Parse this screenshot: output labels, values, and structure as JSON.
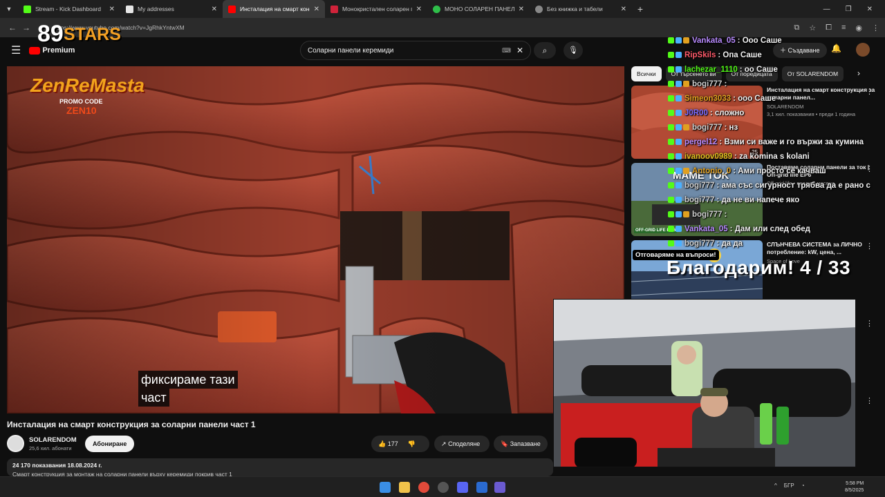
{
  "browser": {
    "tabs": [
      {
        "title": "Stream - Kick Dashboard",
        "color": "#53fc18",
        "active": false
      },
      {
        "title": "My addresses",
        "color": "#e6e6e6",
        "active": false
      },
      {
        "title": "Инсталация на смарт конс",
        "color": "#ff0000",
        "active": true
      },
      {
        "title": "Монокристален соларен пане",
        "color": "#d0233a",
        "active": false
      },
      {
        "title": "МОНО СОЛАРЕН ПАНЕЛ 580W",
        "color": "#2fbf4a",
        "active": false
      },
      {
        "title": "Без книжка и табели",
        "color": "#888888",
        "active": false
      }
    ],
    "close_glyph": "✕",
    "newtab_glyph": "+",
    "url": "https://www.youtube.com/watch?v=JgRhkYntwXM"
  },
  "yt": {
    "logo": "Premium",
    "search_query": "Соларни панели керемиди",
    "create_label": "Създаване",
    "video_title": "Инсталация на смарт конструкция за соларни панели част 1",
    "channel_name": "SOLARENDOM",
    "channel_subs": "25,6 хил. абонати",
    "subscribe_label": "Абониране",
    "likes": "177",
    "share_label": "Споделяне",
    "save_label": "Запазване",
    "desc_stats": "24 170 показвания  18.08.2024 г.",
    "desc_text": "Смарт конструкция за монтаж на соларни панели върху керемиди покрив част 1",
    "subtitle_line1": "фиксираме тази",
    "subtitle_line2": "част"
  },
  "chips": [
    "Всички",
    "От търсенето ви",
    "От поредицата",
    "От SOLARENDOM"
  ],
  "recommendations": [
    {
      "title": "Инсталация на смарт конструкция за соларни панел...",
      "channel": "SOLARENDOM",
      "meta": "3,1 хил. показвания • преди 1 година",
      "duration": "25"
    },
    {
      "title": "Поставяме соларни панели за ток | Off-grid life EP6",
      "channel": "",
      "meta": "Off-grid life • преди 3 месеца",
      "duration": "",
      "badge": "MAME TOK",
      "tag": "OFF-GRID LIFE EP 6"
    },
    {
      "title": "СЛЪНЧЕВА СИСТЕМА за ЛИЧНО потребление: kW, цена, ...",
      "channel": "Space of Love",
      "meta": "",
      "duration": ""
    }
  ],
  "chat": [
    {
      "user": "Vankata_05",
      "color": "#b98cff",
      "msg": ": Ооо Саше"
    },
    {
      "user": "RipSkils",
      "color": "#ff5a6a",
      "msg": ": Опа Саше"
    },
    {
      "user": "lachezar_1110",
      "color": "#53fc18",
      "msg": ": оо Саше"
    },
    {
      "user": "bogi777",
      "color": "#cfcfcf",
      "msg": ":"
    },
    {
      "user": "Simeon3033",
      "color": "#e0a020",
      "msg": ": ооо Саше"
    },
    {
      "user": "J0R00",
      "color": "#7a6cff",
      "msg": ": сложно"
    },
    {
      "user": "bogi777",
      "color": "#cfcfcf",
      "msg": ": нз"
    },
    {
      "user": "pergel12",
      "color": "#b98cff",
      "msg": ": Взми си важе и го вържи за кумина"
    },
    {
      "user": "ivanoov0989",
      "color": "#e0c020",
      "msg": ": za komina s kolani"
    },
    {
      "user": "Antonio_0",
      "color": "#e0a020",
      "msg": ": Ами просто се качваш"
    },
    {
      "user": "bogi777",
      "color": "#cfcfcf",
      "msg": ": ама със сигурност трябва да е рано с"
    },
    {
      "user": "bogi777",
      "color": "#cfcfcf",
      "msg": ": да не ви напече яко"
    },
    {
      "user": "bogi777",
      "color": "#cfcfcf",
      "msg": ":"
    },
    {
      "user": "Vankata_05",
      "color": "#b98cff",
      "msg": ": Дам или след обед"
    },
    {
      "user": "bogi777",
      "color": "#cfcfcf",
      "msg": ": да да"
    }
  ],
  "overlay": {
    "promo_top": "89",
    "promo_stars": "STARS",
    "promo_brand": "ZenReMasta",
    "promo_code_label": "PROMO CODE",
    "promo_code": "ZEN10",
    "ask_label": "Отговаряме на въпроси!",
    "thanks": "Благодарим! 4 / 33"
  },
  "taskbar": {
    "lang": "БГР",
    "time": "5:58 PM",
    "date": "8/5/2025"
  },
  "colors": {
    "accent": "#ff0000",
    "kick": "#53fc18",
    "background": "#0f0f0f"
  }
}
